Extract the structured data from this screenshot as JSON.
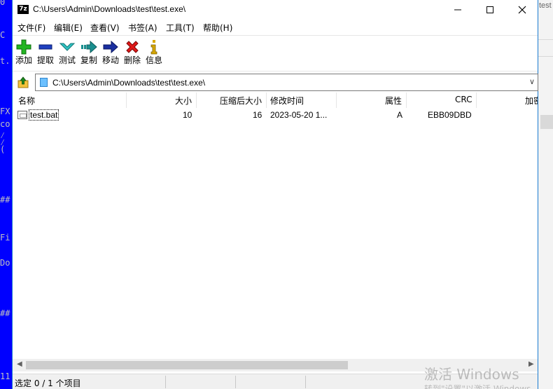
{
  "console_left": {
    "lines": [
      "0",
      "C",
      "t.",
      "FX",
      "co",
      "⁄",
      "⁄",
      "(",
      "##",
      "Fi",
      "Do",
      "##",
      "11"
    ]
  },
  "background_window": {
    "title_fragment": "test"
  },
  "window": {
    "title": "C:\\Users\\Admin\\Downloads\\test\\test.exe\\",
    "app_icon": "7z"
  },
  "menu": [
    "文件(F)",
    "编辑(E)",
    "查看(V)",
    "书签(A)",
    "工具(T)",
    "帮助(H)"
  ],
  "toolbar": [
    {
      "label": "添加",
      "icon": "add-icon"
    },
    {
      "label": "提取",
      "icon": "extract-icon"
    },
    {
      "label": "测试",
      "icon": "test-icon"
    },
    {
      "label": "复制",
      "icon": "copy-icon"
    },
    {
      "label": "移动",
      "icon": "move-icon"
    },
    {
      "label": "删除",
      "icon": "delete-icon"
    },
    {
      "label": "信息",
      "icon": "info-icon"
    }
  ],
  "address": {
    "path": "C:\\Users\\Admin\\Downloads\\test\\test.exe\\"
  },
  "columns": [
    "名称",
    "大小",
    "压缩后大小",
    "修改时间",
    "属性",
    "CRC",
    "加密"
  ],
  "files": [
    {
      "name": "test.bat",
      "size": "10",
      "packed": "16",
      "modified": "2023-05-20 1...",
      "attr": "A",
      "crc": "EBB09DBD"
    }
  ],
  "status": {
    "selection": "选定 0 / 1 个项目"
  },
  "watermark": {
    "line1": "激活 Windows",
    "line2": "转到\"设置\"以激活 Windows"
  },
  "colors": {
    "console_bg": "#0000ff",
    "add": "#22b522",
    "extract": "#1f3fbf",
    "test": "#2fc1c1",
    "copy": "#1a8f8f",
    "move": "#1a2fa0",
    "delete": "#e01818",
    "info": "#d9a800"
  }
}
